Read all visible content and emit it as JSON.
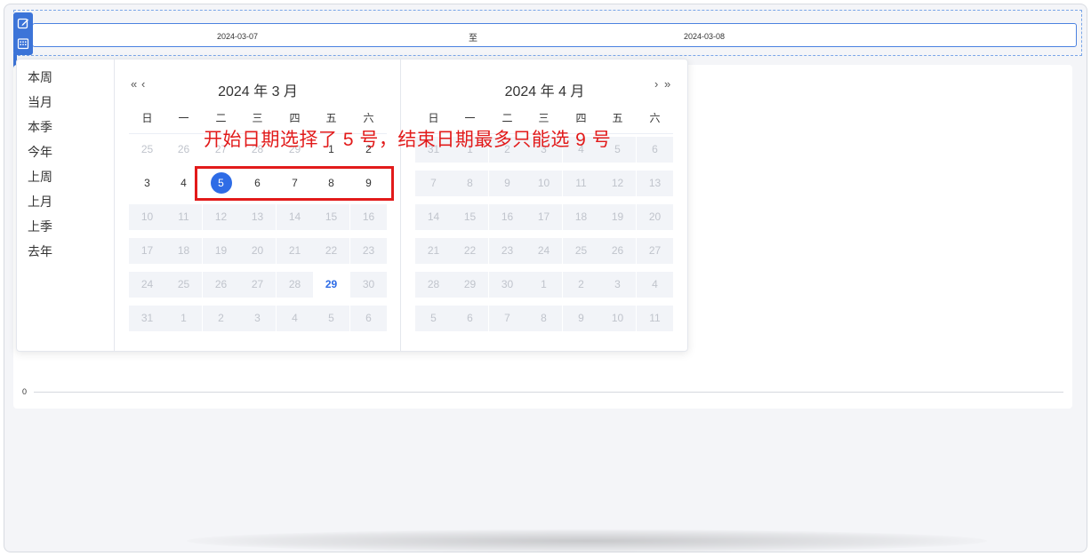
{
  "range": {
    "start": "2024-03-07",
    "separator": "至",
    "end": "2024-03-08"
  },
  "shortcuts": [
    "本周",
    "当月",
    "本季",
    "今年",
    "上周",
    "上月",
    "上季",
    "去年"
  ],
  "weekdays": [
    "日",
    "一",
    "二",
    "三",
    "四",
    "五",
    "六"
  ],
  "left_panel": {
    "title": "2024 年 3 月",
    "nav_prev_year": "«",
    "nav_prev_month": "‹",
    "weeks": [
      [
        {
          "d": "25",
          "s": "dim"
        },
        {
          "d": "26",
          "s": "dim"
        },
        {
          "d": "27",
          "s": "dim"
        },
        {
          "d": "28",
          "s": "dim"
        },
        {
          "d": "29",
          "s": "dim"
        },
        {
          "d": "1",
          "s": "cur"
        },
        {
          "d": "2",
          "s": "cur"
        }
      ],
      [
        {
          "d": "3",
          "s": "cur"
        },
        {
          "d": "4",
          "s": "cur"
        },
        {
          "d": "5",
          "s": "selected"
        },
        {
          "d": "6",
          "s": "cur"
        },
        {
          "d": "7",
          "s": "cur"
        },
        {
          "d": "8",
          "s": "cur"
        },
        {
          "d": "9",
          "s": "cur"
        }
      ],
      [
        {
          "d": "10",
          "s": "disabled"
        },
        {
          "d": "11",
          "s": "disabled"
        },
        {
          "d": "12",
          "s": "disabled"
        },
        {
          "d": "13",
          "s": "disabled"
        },
        {
          "d": "14",
          "s": "disabled"
        },
        {
          "d": "15",
          "s": "disabled"
        },
        {
          "d": "16",
          "s": "disabled"
        }
      ],
      [
        {
          "d": "17",
          "s": "disabled"
        },
        {
          "d": "18",
          "s": "disabled"
        },
        {
          "d": "19",
          "s": "disabled"
        },
        {
          "d": "20",
          "s": "disabled"
        },
        {
          "d": "21",
          "s": "disabled"
        },
        {
          "d": "22",
          "s": "disabled"
        },
        {
          "d": "23",
          "s": "disabled"
        }
      ],
      [
        {
          "d": "24",
          "s": "disabled"
        },
        {
          "d": "25",
          "s": "disabled"
        },
        {
          "d": "26",
          "s": "disabled"
        },
        {
          "d": "27",
          "s": "disabled"
        },
        {
          "d": "28",
          "s": "disabled"
        },
        {
          "d": "29",
          "s": "today"
        },
        {
          "d": "30",
          "s": "disabled"
        }
      ],
      [
        {
          "d": "31",
          "s": "disabled"
        },
        {
          "d": "1",
          "s": "disabled"
        },
        {
          "d": "2",
          "s": "disabled"
        },
        {
          "d": "3",
          "s": "disabled"
        },
        {
          "d": "4",
          "s": "disabled"
        },
        {
          "d": "5",
          "s": "disabled"
        },
        {
          "d": "6",
          "s": "disabled"
        }
      ]
    ]
  },
  "right_panel": {
    "title": "2024 年 4 月",
    "nav_next_month": "›",
    "nav_next_year": "»",
    "weeks": [
      [
        {
          "d": "31",
          "s": "disabled"
        },
        {
          "d": "1",
          "s": "disabled"
        },
        {
          "d": "2",
          "s": "disabled"
        },
        {
          "d": "3",
          "s": "disabled"
        },
        {
          "d": "4",
          "s": "disabled"
        },
        {
          "d": "5",
          "s": "disabled"
        },
        {
          "d": "6",
          "s": "disabled"
        }
      ],
      [
        {
          "d": "7",
          "s": "disabled"
        },
        {
          "d": "8",
          "s": "disabled"
        },
        {
          "d": "9",
          "s": "disabled"
        },
        {
          "d": "10",
          "s": "disabled"
        },
        {
          "d": "11",
          "s": "disabled"
        },
        {
          "d": "12",
          "s": "disabled"
        },
        {
          "d": "13",
          "s": "disabled"
        }
      ],
      [
        {
          "d": "14",
          "s": "disabled"
        },
        {
          "d": "15",
          "s": "disabled"
        },
        {
          "d": "16",
          "s": "disabled"
        },
        {
          "d": "17",
          "s": "disabled"
        },
        {
          "d": "18",
          "s": "disabled"
        },
        {
          "d": "19",
          "s": "disabled"
        },
        {
          "d": "20",
          "s": "disabled"
        }
      ],
      [
        {
          "d": "21",
          "s": "disabled"
        },
        {
          "d": "22",
          "s": "disabled"
        },
        {
          "d": "23",
          "s": "disabled"
        },
        {
          "d": "24",
          "s": "disabled"
        },
        {
          "d": "25",
          "s": "disabled"
        },
        {
          "d": "26",
          "s": "disabled"
        },
        {
          "d": "27",
          "s": "disabled"
        }
      ],
      [
        {
          "d": "28",
          "s": "disabled"
        },
        {
          "d": "29",
          "s": "disabled"
        },
        {
          "d": "30",
          "s": "disabled"
        },
        {
          "d": "1",
          "s": "disabled"
        },
        {
          "d": "2",
          "s": "disabled"
        },
        {
          "d": "3",
          "s": "disabled"
        },
        {
          "d": "4",
          "s": "disabled"
        }
      ],
      [
        {
          "d": "5",
          "s": "disabled"
        },
        {
          "d": "6",
          "s": "disabled"
        },
        {
          "d": "7",
          "s": "disabled"
        },
        {
          "d": "8",
          "s": "disabled"
        },
        {
          "d": "9",
          "s": "disabled"
        },
        {
          "d": "10",
          "s": "disabled"
        },
        {
          "d": "11",
          "s": "disabled"
        }
      ]
    ]
  },
  "annotation": "开始日期选择了 5 号，结束日期最多只能选 9 号",
  "chart_axis": {
    "zero_label": "0"
  },
  "colors": {
    "accent": "#2e6ce6",
    "annotation": "#e21a1a",
    "disabled_bg": "#f2f4f8"
  },
  "icons": {
    "toolbar_top": "edit-icon",
    "toolbar_bottom": "calendar-grid-icon"
  }
}
